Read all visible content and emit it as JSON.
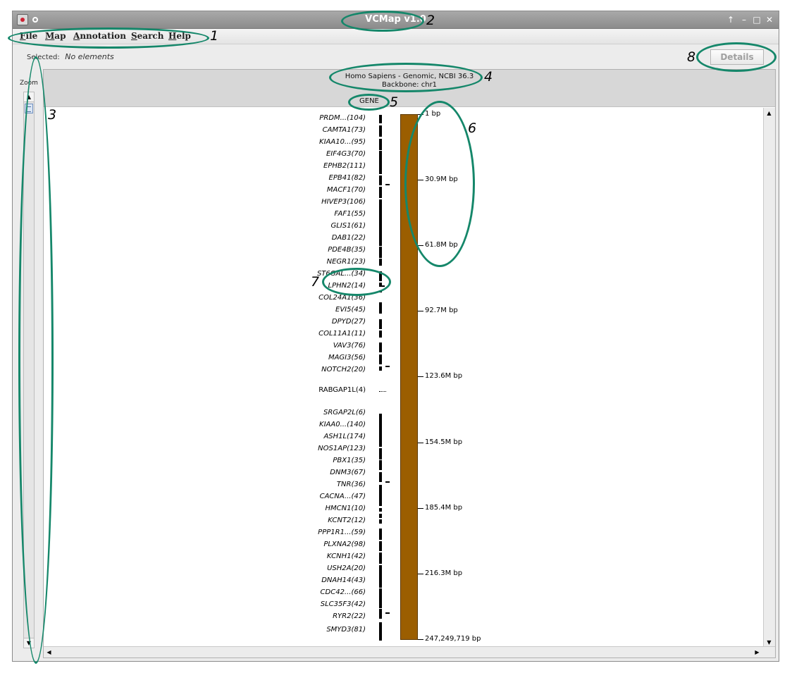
{
  "window": {
    "title": "VCMap v1.0"
  },
  "menu": [
    {
      "label": "File"
    },
    {
      "label": "Map"
    },
    {
      "label": "Annotation"
    },
    {
      "label": "Search"
    },
    {
      "label": "Help"
    }
  ],
  "selection": {
    "label": "Selected:",
    "value": "No elements"
  },
  "details_button": {
    "label": "Details",
    "enabled": false
  },
  "zoom": {
    "label": "Zoom"
  },
  "map": {
    "header_line1": "Homo Sapiens - Genomic, NCBI 36.3",
    "header_line2": "Backbone: chr1",
    "annotation_column": "GENE",
    "chromosome_color": "#9b5e00",
    "axis_labels": [
      "1 bp",
      "30.9M bp",
      "61.8M bp",
      "92.7M bp",
      "123.6M bp",
      "154.5M bp",
      "185.4M bp",
      "216.3M bp",
      "247,249,719 bp"
    ],
    "genes": [
      "PRDM...(104)",
      "CAMTA1(73)",
      "KIAA10...(95)",
      "EIF4G3(70)",
      "EPHB2(111)",
      "EPB41(82)",
      "MACF1(70)",
      "HIVEP3(106)",
      "FAF1(55)",
      "GLIS1(61)",
      "DAB1(22)",
      "PDE4B(35)",
      "NEGR1(23)",
      "ST6GAL...(34)",
      "LPHN2(14)",
      "COL24A1(36)",
      "EVI5(45)",
      "DPYD(27)",
      "COL11A1(11)",
      "VAV3(76)",
      "MAGI3(56)",
      "NOTCH2(20)",
      "RABGAP1L(4)",
      "SRGAP2L(6)",
      "KIAA0...(140)",
      "ASH1L(174)",
      "NOS1AP(123)",
      "PBX1(35)",
      "DNM3(67)",
      "TNR(36)",
      "CACNA...(47)",
      "HMCN1(10)",
      "KCNT2(12)",
      "PPP1R1...(59)",
      "PLXNA2(98)",
      "KCNH1(42)",
      "USH2A(20)",
      "DNAH14(43)",
      "CDC42...(66)",
      "SLC35F3(42)",
      "RYR2(22)",
      "SMYD3(81)"
    ]
  },
  "annotations": [
    "1",
    "2",
    "3",
    "4",
    "5",
    "6",
    "7",
    "8"
  ],
  "colors": {
    "annotation": "#15876a"
  }
}
